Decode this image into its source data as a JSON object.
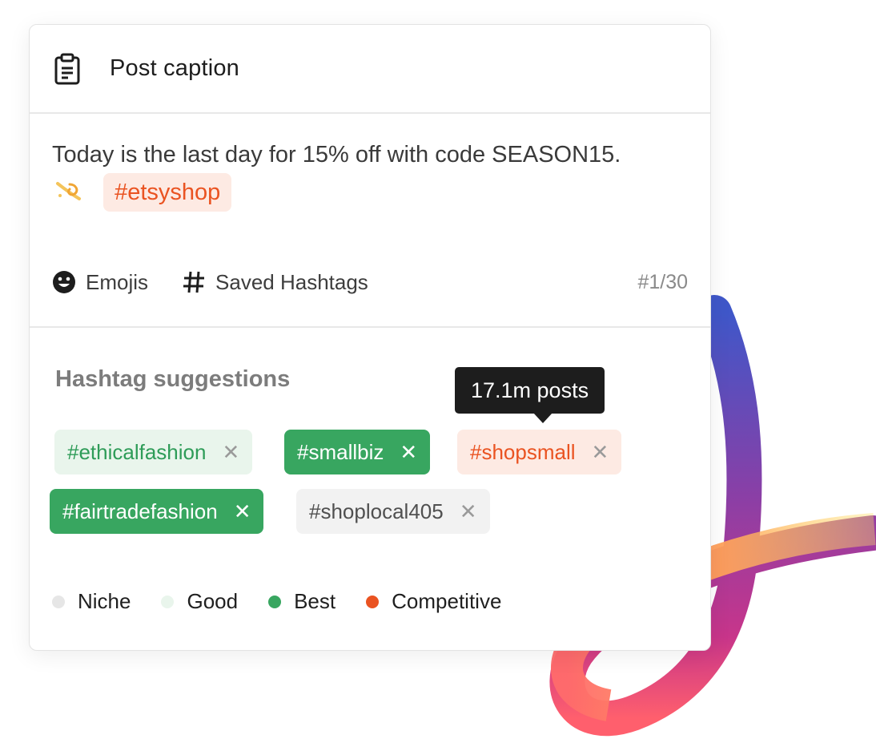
{
  "card": {
    "title": "Post caption",
    "title_icon": "clipboard-icon"
  },
  "caption": {
    "text": "Today is the last day for 15% off with code SEASON15.",
    "emoji": "dizzy-emoji",
    "hashtag": "#etsyshop"
  },
  "toolbar": {
    "emojis_label": "Emojis",
    "emojis_icon": "smiley-icon",
    "hashtags_label": "Saved Hashtags",
    "hashtags_icon": "hash-icon",
    "counter": "#1/30"
  },
  "suggestions": {
    "title": "Hashtag suggestions",
    "tooltip": "17.1m posts",
    "tags": [
      {
        "label": "#ethicalfashion",
        "category": "Good"
      },
      {
        "label": "#smallbiz",
        "category": "Best"
      },
      {
        "label": "#shopsmall",
        "category": "Competitive"
      },
      {
        "label": "#fairtradefashion",
        "category": "Best"
      },
      {
        "label": "#shoplocal405",
        "category": "Niche"
      }
    ],
    "remove_glyph": "✕"
  },
  "legend": [
    {
      "label": "Niche",
      "color": "#e6e6e6"
    },
    {
      "label": "Good",
      "color": "#e9f5ec"
    },
    {
      "label": "Best",
      "color": "#38a660"
    },
    {
      "label": "Competitive",
      "color": "#ea5321"
    }
  ],
  "colors": {
    "accent_orange": "#ea5321",
    "best_green": "#38a660",
    "good_green_bg": "#e9f5ec",
    "tooltip_bg": "#1d1d1d"
  }
}
